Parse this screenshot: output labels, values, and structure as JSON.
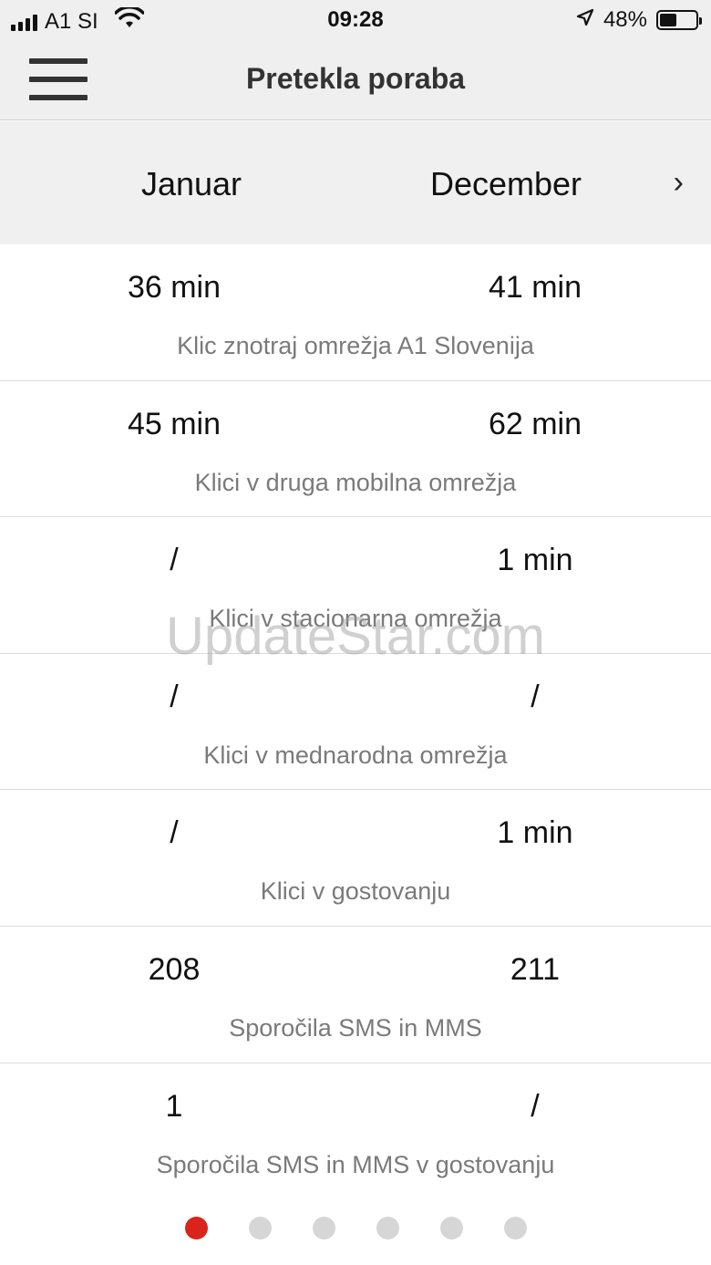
{
  "status_bar": {
    "carrier": "A1 SI",
    "time": "09:28",
    "battery_percent": "48%",
    "battery_level": 0.48,
    "icons": [
      "signal-icon",
      "wifi-icon",
      "location-arrow-icon",
      "battery-icon"
    ]
  },
  "nav": {
    "title": "Pretekla poraba",
    "menu_icon": "hamburger-menu-icon"
  },
  "months": {
    "left": "Januar",
    "right": "December",
    "next_icon": "chevron-right-icon",
    "next_glyph": "›"
  },
  "rows": [
    {
      "left": "36 min",
      "right": "41 min",
      "label": "Klic znotraj omrežja A1 Slovenija"
    },
    {
      "left": "45 min",
      "right": "62 min",
      "label": "Klici v druga mobilna omrežja"
    },
    {
      "left": "/",
      "right": "1 min",
      "label": "Klici v stacionarna omrežja"
    },
    {
      "left": "/",
      "right": "/",
      "label": "Klici v mednarodna omrežja"
    },
    {
      "left": "/",
      "right": "1 min",
      "label": "Klici v gostovanju"
    },
    {
      "left": "208",
      "right": "211",
      "label": "Sporočila SMS in MMS"
    },
    {
      "left": "1",
      "right": "/",
      "label": "Sporočila SMS in MMS v gostovanju"
    }
  ],
  "watermark": "UpdateStar.com",
  "pager": {
    "count": 6,
    "active_index": 0,
    "colors": {
      "active": "#d9241c",
      "inactive": "#d6d6d6"
    }
  }
}
